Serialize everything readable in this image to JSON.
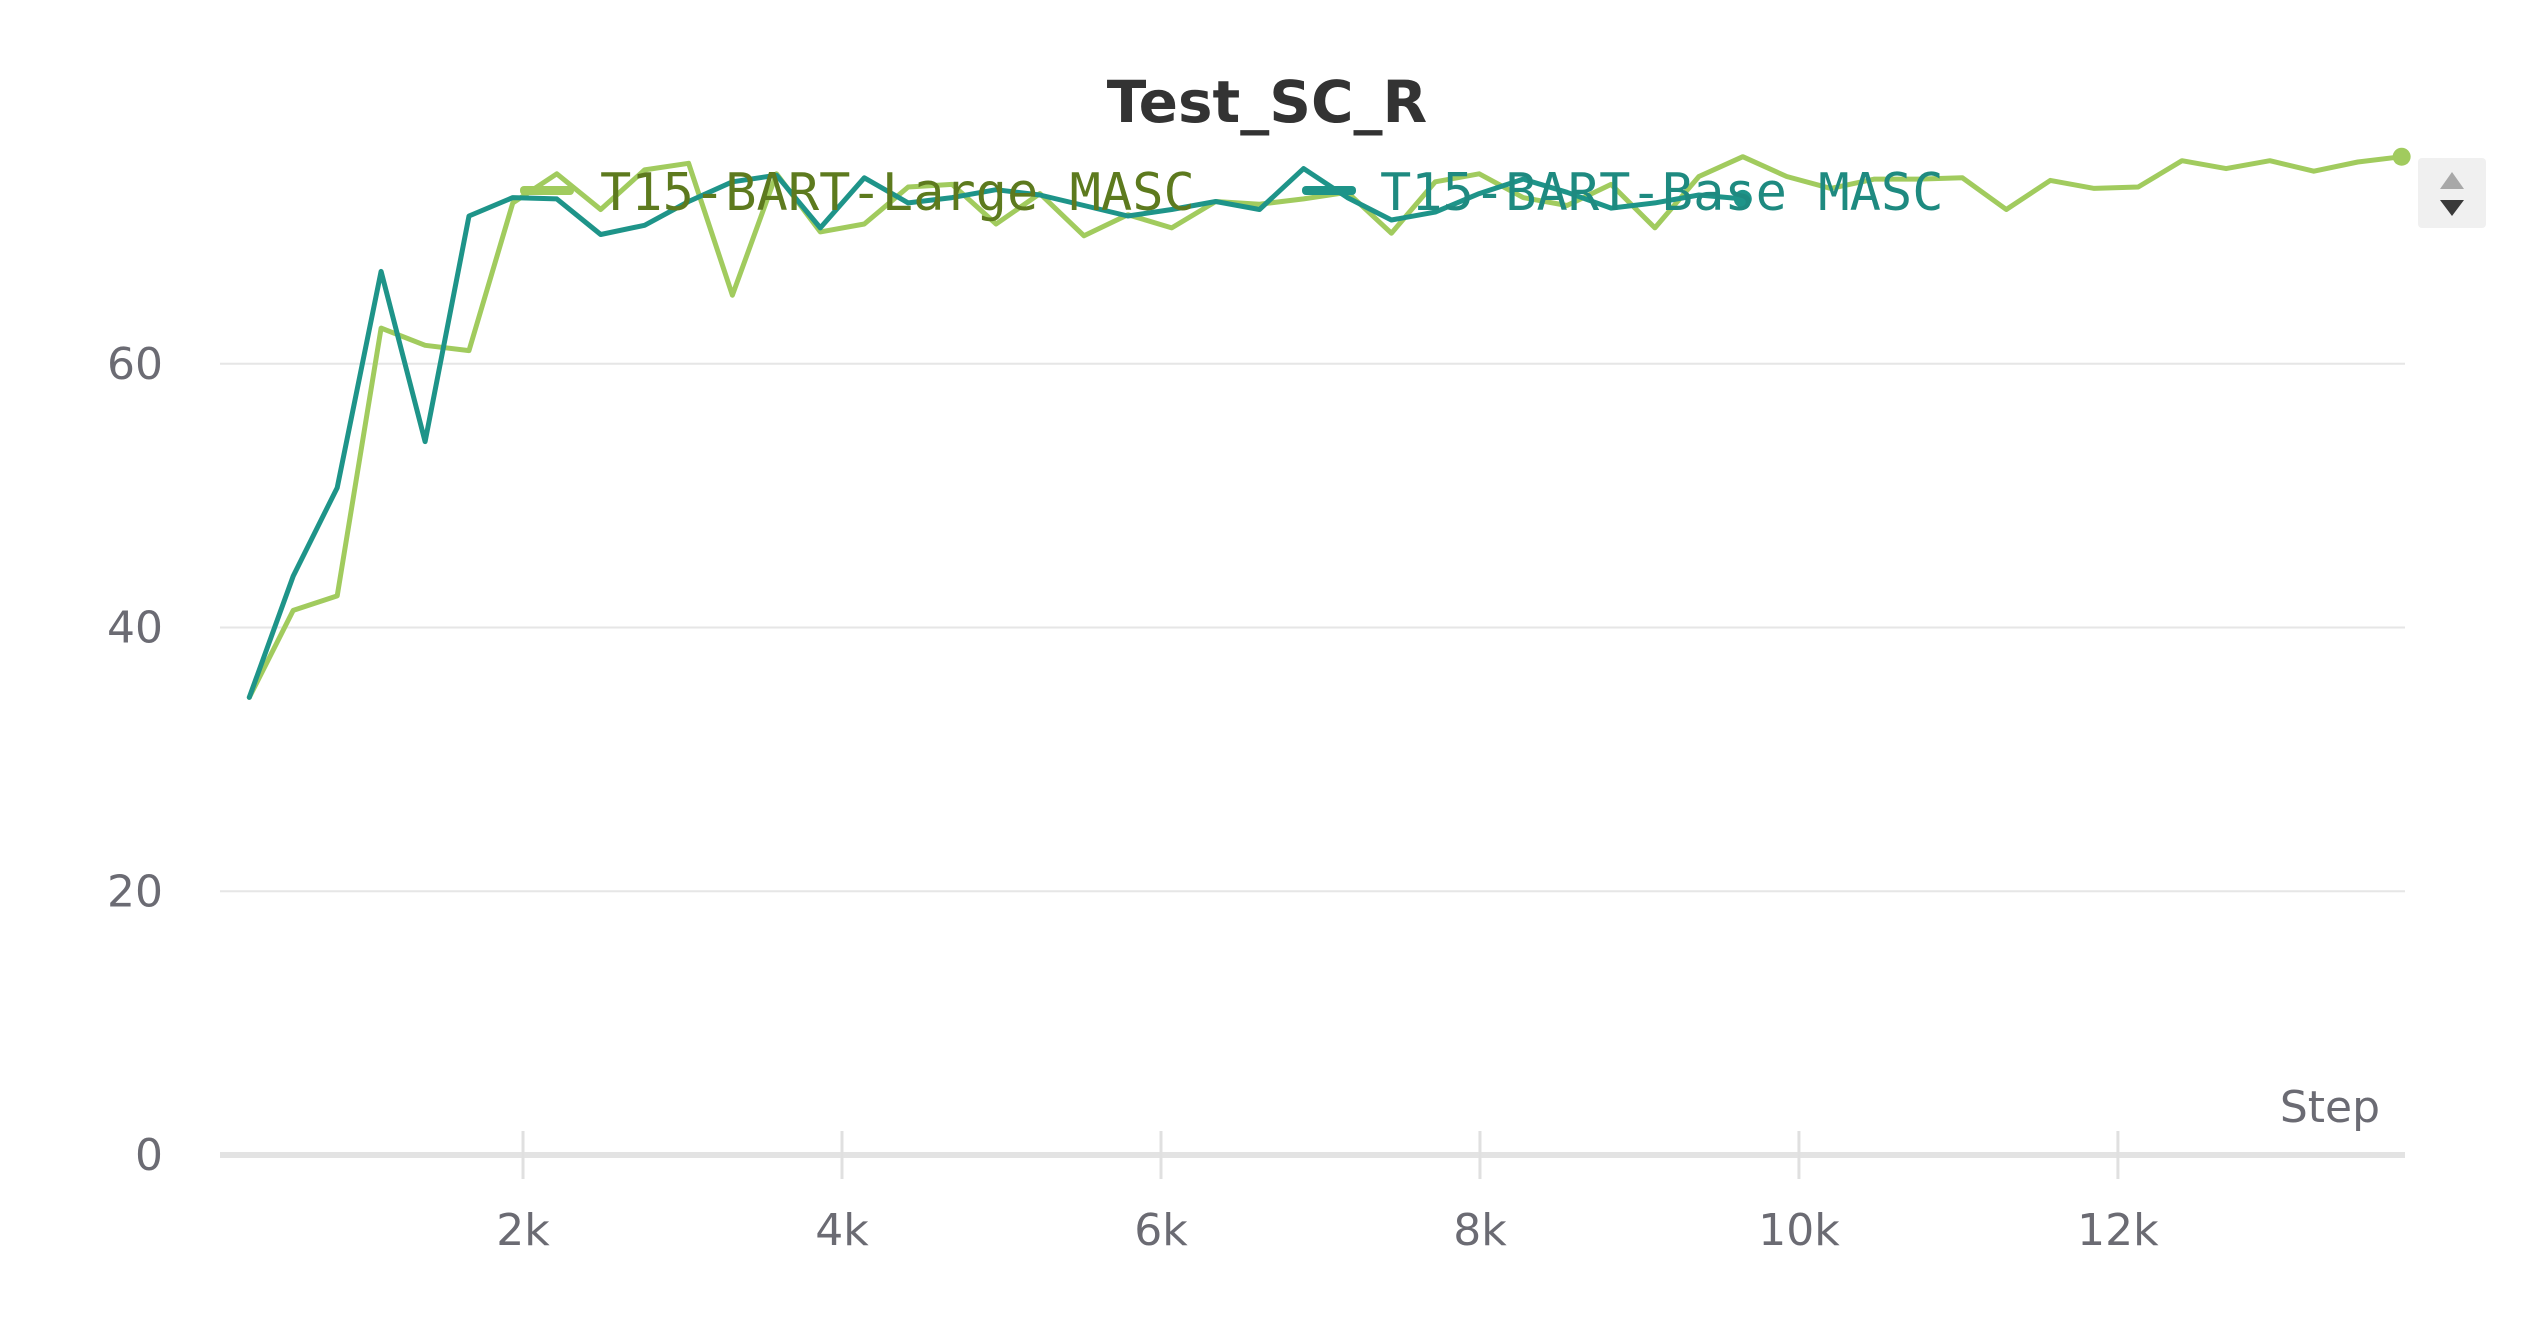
{
  "chart_data": {
    "type": "line",
    "title": "Test_SC_R",
    "xlabel": "Step",
    "ylabel": "",
    "xlim": [
      100,
      13800
    ],
    "ylim": [
      0,
      80
    ],
    "x_ticks": [
      2000,
      4000,
      6000,
      8000,
      10000,
      12000
    ],
    "x_tick_labels": [
      "2k",
      "4k",
      "6k",
      "8k",
      "10k",
      "12k"
    ],
    "y_ticks": [
      0,
      20,
      40,
      60
    ],
    "y_tick_labels": [
      "0",
      "20",
      "40",
      "60"
    ],
    "grid": true,
    "legend": "top-center",
    "series": [
      {
        "name": "T15-BART-Large MASC",
        "color": "#a1cb5e",
        "legend_text_color": "#5d7a1e",
        "x": [
          284,
          559,
          835,
          1110,
          1386,
          1661,
          1936,
          2212,
          2487,
          2762,
          3038,
          3313,
          3589,
          3864,
          4140,
          4415,
          4690,
          4966,
          5241,
          5517,
          5792,
          6067,
          6343,
          6618,
          6894,
          7169,
          7445,
          7720,
          7995,
          8271,
          8546,
          8822,
          9097,
          9373,
          9648,
          9923,
          10199,
          10474,
          10750,
          11025,
          11300,
          11576,
          11851,
          12127,
          12402,
          12678,
          12953,
          13228,
          13504,
          13779
        ],
        "y": [
          34.7,
          41.3,
          42.4,
          62.7,
          61.4,
          61.0,
          72.2,
          74.4,
          71.7,
          74.7,
          75.2,
          65.2,
          74.4,
          70.0,
          70.6,
          73.4,
          73.6,
          70.6,
          72.9,
          69.7,
          71.3,
          70.3,
          72.3,
          72.1,
          72.5,
          73.0,
          69.9,
          73.8,
          74.4,
          72.6,
          72.0,
          73.6,
          70.3,
          74.2,
          75.7,
          74.2,
          73.3,
          74.0,
          74.0,
          74.1,
          71.7,
          73.9,
          73.3,
          73.4,
          75.4,
          74.8,
          75.4,
          74.6,
          75.3,
          75.7
        ]
      },
      {
        "name": "T15-BART-Base MASC",
        "color": "#1e9489",
        "legend_text_color": "#1e8a80",
        "x": [
          284,
          559,
          835,
          1110,
          1386,
          1661,
          1936,
          2212,
          2487,
          2762,
          3038,
          3313,
          3589,
          3864,
          4140,
          4415,
          4690,
          4966,
          5241,
          5517,
          5792,
          6067,
          6343,
          6618,
          6894,
          7169,
          7445,
          7720,
          7995,
          8271,
          8546,
          8822,
          9097,
          9373,
          9648
        ],
        "y": [
          34.7,
          43.9,
          50.6,
          67.0,
          54.1,
          71.2,
          72.6,
          72.5,
          69.8,
          70.5,
          72.3,
          73.8,
          74.3,
          70.3,
          74.1,
          72.2,
          72.6,
          73.2,
          72.8,
          72.0,
          71.2,
          71.7,
          72.3,
          71.7,
          74.8,
          72.6,
          70.9,
          71.5,
          72.9,
          74.0,
          73.0,
          71.8,
          72.2,
          72.8,
          72.5
        ]
      }
    ]
  }
}
